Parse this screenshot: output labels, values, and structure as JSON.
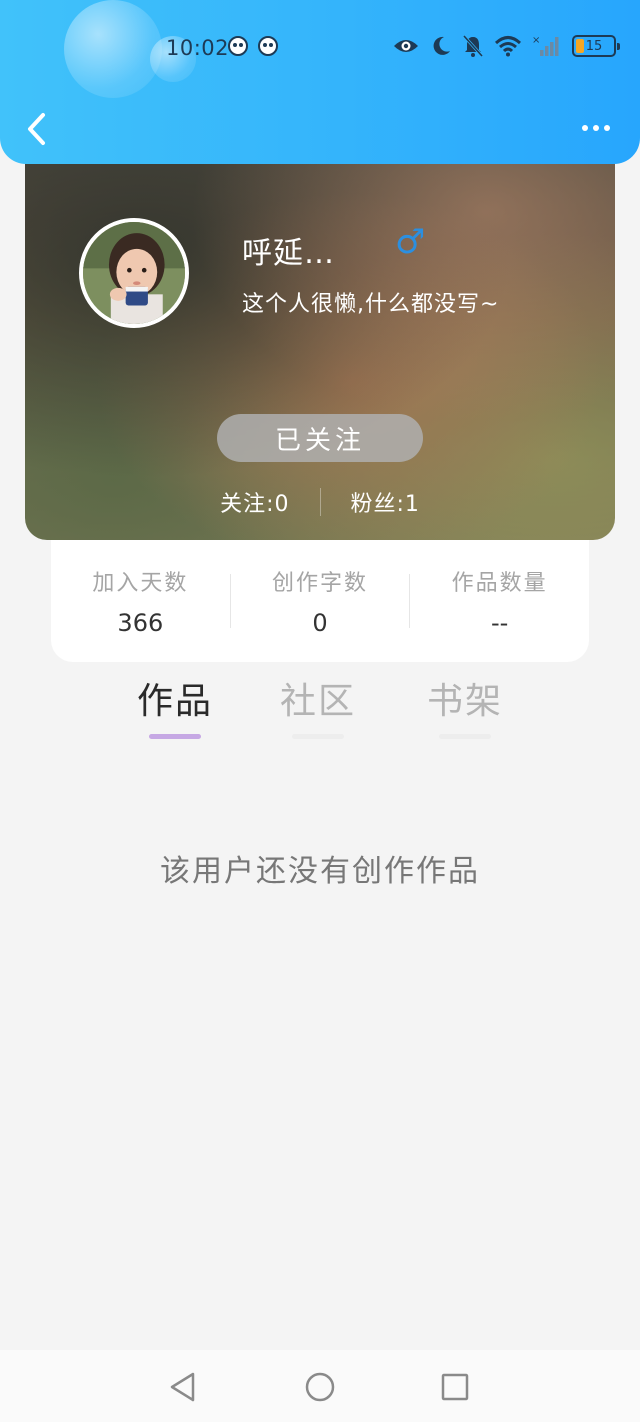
{
  "status_bar": {
    "time": "10:02",
    "battery_level": "15"
  },
  "profile": {
    "nickname": "呼延…",
    "gender_symbol": "♂",
    "signature": "这个人很懒,什么都没写~",
    "follow_button": "已关注",
    "following": "关注:0",
    "followers": "粉丝:1"
  },
  "stats": [
    {
      "label": "加入天数",
      "value": "366"
    },
    {
      "label": "创作字数",
      "value": "0"
    },
    {
      "label": "作品数量",
      "value": "--"
    }
  ],
  "tabs": [
    {
      "label": "作品",
      "active": true
    },
    {
      "label": "社区",
      "active": false
    },
    {
      "label": "书架",
      "active": false
    }
  ],
  "empty_state": "该用户还没有创作作品",
  "colors": {
    "header_start": "#41c2fa",
    "header_end": "#27a6fd",
    "active_tab_underline": "#c6a8e4",
    "gender_color": "#2b8fe0"
  }
}
